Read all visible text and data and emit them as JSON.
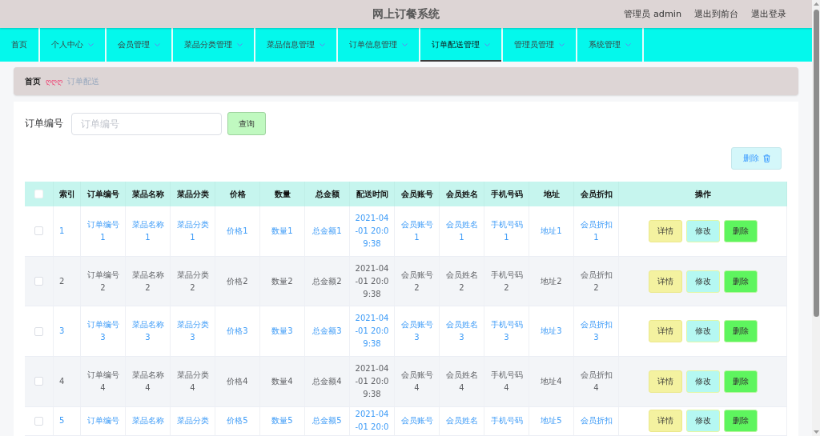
{
  "header": {
    "title": "网上订餐系统",
    "user": "管理员 admin",
    "links": [
      "退出到前台",
      "退出登录"
    ]
  },
  "nav": {
    "items": [
      {
        "label": "首页",
        "dropdown": false,
        "selected": false
      },
      {
        "label": "个人中心",
        "dropdown": true,
        "selected": false
      },
      {
        "label": "会员管理",
        "dropdown": true,
        "selected": false
      },
      {
        "label": "菜品分类管理",
        "dropdown": true,
        "selected": false
      },
      {
        "label": "菜品信息管理",
        "dropdown": true,
        "selected": false
      },
      {
        "label": "订单信息管理",
        "dropdown": true,
        "selected": false
      },
      {
        "label": "订单配送管理",
        "dropdown": true,
        "selected": true
      },
      {
        "label": "管理员管理",
        "dropdown": true,
        "selected": false
      },
      {
        "label": "系统管理",
        "dropdown": true,
        "selected": false
      }
    ]
  },
  "breadcrumb": {
    "home": "首页",
    "separator": "ღღღ",
    "current": "订单配送"
  },
  "search": {
    "label": "订单编号",
    "placeholder": "订单编号",
    "button": "查询"
  },
  "toolbar": {
    "delete_button": "删除"
  },
  "table": {
    "select_all": {
      "checked": false
    },
    "columns": [
      "索引",
      "订单编号",
      "菜品名称",
      "菜品分类",
      "价格",
      "数量",
      "总金额",
      "配送时间",
      "会员账号",
      "会员姓名",
      "手机号码",
      "地址",
      "会员折扣",
      "操作"
    ],
    "rows": [
      {
        "striped": false,
        "checked": false,
        "cells": [
          "1",
          "订单编号1",
          "菜品名称1",
          "菜品分类1",
          "价格1",
          "数量1",
          "总金额1",
          "2021-04-01 20:09:38",
          "会员账号1",
          "会员姓名1",
          "手机号码1",
          "地址1",
          "会员折扣1"
        ],
        "actions": [
          {
            "label": "详情",
            "kind": "detail"
          },
          {
            "label": "修改",
            "kind": "edit"
          },
          {
            "label": "删除",
            "kind": "delete"
          }
        ]
      },
      {
        "striped": true,
        "checked": false,
        "cells": [
          "2",
          "订单编号2",
          "菜品名称2",
          "菜品分类2",
          "价格2",
          "数量2",
          "总金额2",
          "2021-04-01 20:09:38",
          "会员账号2",
          "会员姓名2",
          "手机号码2",
          "地址2",
          "会员折扣2"
        ],
        "actions": [
          {
            "label": "详情",
            "kind": "detail"
          },
          {
            "label": "修改",
            "kind": "edit"
          },
          {
            "label": "删除",
            "kind": "delete"
          }
        ]
      },
      {
        "striped": false,
        "checked": false,
        "cells": [
          "3",
          "订单编号3",
          "菜品名称3",
          "菜品分类3",
          "价格3",
          "数量3",
          "总金额3",
          "2021-04-01 20:09:38",
          "会员账号3",
          "会员姓名3",
          "手机号码3",
          "地址3",
          "会员折扣3"
        ],
        "actions": [
          {
            "label": "详情",
            "kind": "detail"
          },
          {
            "label": "修改",
            "kind": "edit"
          },
          {
            "label": "删除",
            "kind": "delete"
          }
        ]
      },
      {
        "striped": true,
        "checked": false,
        "cells": [
          "4",
          "订单编号4",
          "菜品名称4",
          "菜品分类4",
          "价格4",
          "数量4",
          "总金额4",
          "2021-04-01 20:09:38",
          "会员账号4",
          "会员姓名4",
          "手机号码4",
          "地址4",
          "会员折扣4"
        ],
        "actions": [
          {
            "label": "详情",
            "kind": "detail"
          },
          {
            "label": "修改",
            "kind": "edit"
          },
          {
            "label": "删除",
            "kind": "delete"
          }
        ]
      },
      {
        "striped": false,
        "checked": false,
        "cells": [
          "5",
          "订单编号",
          "菜品名称",
          "菜品分类",
          "价格5",
          "数量5",
          "总金额5",
          "2021-04-01 20:0",
          "会员账号",
          "会员姓名",
          "手机号码",
          "地址5",
          "会员折扣"
        ],
        "actions": [
          {
            "label": "详情",
            "kind": "detail"
          },
          {
            "label": "修改",
            "kind": "edit"
          },
          {
            "label": "删除",
            "kind": "delete"
          }
        ]
      }
    ]
  }
}
